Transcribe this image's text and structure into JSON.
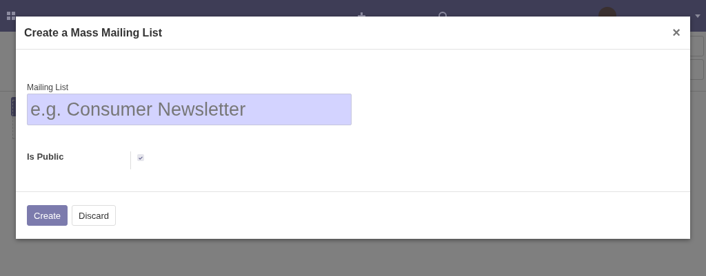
{
  "dialog": {
    "title": "Create a Mass Mailing List",
    "close": "×",
    "fields": [
      {
        "kind": "text",
        "label": "Mailing List",
        "placeholder": "e.g. Consumer Newsletter"
      },
      {
        "kind": "checkbox",
        "label": "Is Public",
        "checked": true
      }
    ],
    "buttons": [
      {
        "label": "Create",
        "kind": "primary"
      },
      {
        "label": "Discard",
        "kind": "secondary"
      }
    ]
  }
}
